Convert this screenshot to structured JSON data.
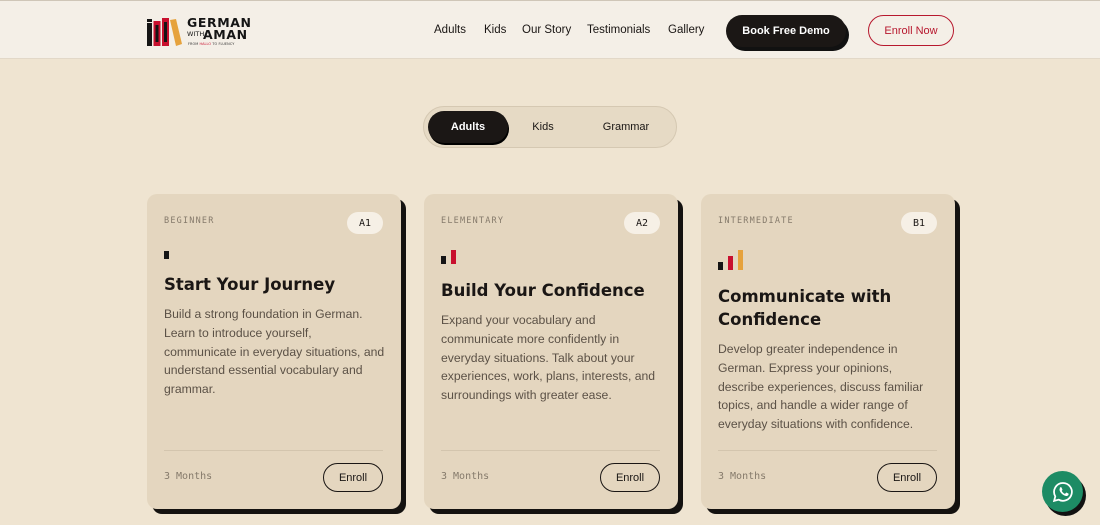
{
  "brand": {
    "name_line1": "GERMAN",
    "name_with": "WITH",
    "name_line2": "AMAN",
    "tagline_pre": "FROM ",
    "tagline_red": "HALLO",
    "tagline_post": " TO FLUENCY"
  },
  "nav": {
    "links": [
      "Adults",
      "Kids",
      "Our Story",
      "Testimonials",
      "Gallery"
    ],
    "cta_demo": "Book Free Demo",
    "cta_enroll": "Enroll Now"
  },
  "tabs": {
    "items": [
      "Adults",
      "Kids",
      "Grammar"
    ],
    "active": "Adults"
  },
  "colors": {
    "accent_red": "#c8102e",
    "accent_yellow": "#e6a23c",
    "dark": "#1b1715",
    "whatsapp": "#1d8b64"
  },
  "cards": [
    {
      "level": "BEGINNER",
      "badge": "A1",
      "title": "Start Your Journey",
      "description": "Build a strong foundation in German. Learn to introduce yourself, communicate in everyday situations, and understand essential vocabulary and grammar.",
      "duration": "3 Months",
      "enroll": "Enroll",
      "level_bars": 1
    },
    {
      "level": "ELEMENTARY",
      "badge": "A2",
      "title": "Build Your Confidence",
      "description": "Expand your vocabulary and communicate more confidently in everyday situations. Talk about your experiences, work, plans, interests, and surroundings with greater ease.",
      "duration": "3 Months",
      "enroll": "Enroll",
      "level_bars": 2
    },
    {
      "level": "INTERMEDIATE",
      "badge": "B1",
      "title": "Communicate with Confidence",
      "description": "Develop greater independence in German. Express your opinions, describe experiences, discuss familiar topics, and handle a wider range of everyday situations with confidence.",
      "duration": "3 Months",
      "enroll": "Enroll",
      "level_bars": 3
    }
  ],
  "icons": {
    "whatsapp": "whatsapp-icon"
  }
}
